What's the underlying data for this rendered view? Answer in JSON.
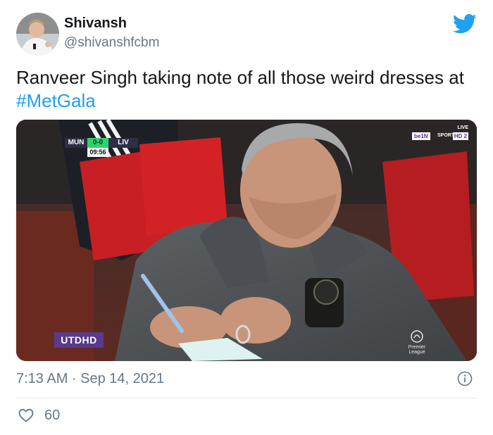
{
  "author": {
    "name": "Shivansh",
    "handle": "@shivanshfcbm"
  },
  "tweet": {
    "text_prefix": "Ranveer Singh taking note of all those weird dresses at ",
    "hashtag": "#MetGala"
  },
  "media": {
    "scorebug": {
      "home": "MUN",
      "score": "0-0",
      "away": "LIV",
      "clock": "09:56"
    },
    "broadcaster": {
      "live": "LIVE",
      "brand": "be1N",
      "sports": "SPORTS",
      "hd": "HD 2"
    },
    "watermark": "UTDHD",
    "league_logo": "Premier League"
  },
  "footer": {
    "timestamp": "7:13 AM · Sep 14, 2021",
    "likes": "60"
  },
  "icons": {
    "twitter": "twitter-bird-icon",
    "info": "info-icon",
    "like": "heart-icon"
  },
  "colors": {
    "accent": "#1da1f2",
    "text": "#14171a",
    "muted": "#657786",
    "divider": "#e1e8ed"
  }
}
